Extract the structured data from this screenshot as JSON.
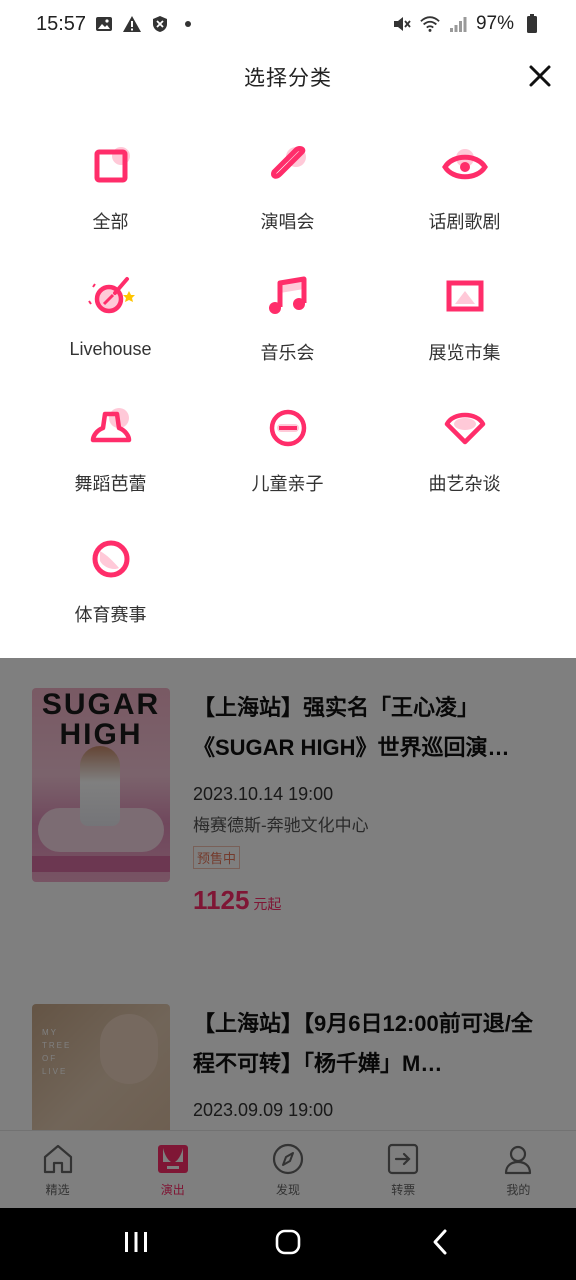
{
  "status_bar": {
    "time": "15:57",
    "battery": "97%",
    "left_icons": [
      "image-icon",
      "warning-icon",
      "shield-icon",
      "dot-icon"
    ],
    "right_icons": [
      "mute-icon",
      "wifi-icon",
      "signal-icon",
      "battery-icon"
    ]
  },
  "sheet": {
    "title": "选择分类",
    "close_icon": "close-icon",
    "categories": [
      {
        "label": "全部",
        "icon": "all-icon"
      },
      {
        "label": "演唱会",
        "icon": "microphone-icon"
      },
      {
        "label": "话剧歌剧",
        "icon": "eye-mask-icon"
      },
      {
        "label": "Livehouse",
        "icon": "guitar-icon"
      },
      {
        "label": "音乐会",
        "icon": "music-note-icon"
      },
      {
        "label": "展览市集",
        "icon": "picture-frame-icon"
      },
      {
        "label": "舞蹈芭蕾",
        "icon": "tutu-icon"
      },
      {
        "label": "儿童亲子",
        "icon": "circle-minus-icon"
      },
      {
        "label": "曲艺杂谈",
        "icon": "fan-icon"
      },
      {
        "label": "体育赛事",
        "icon": "ball-icon"
      }
    ],
    "accent_color": "#ff2d6a"
  },
  "events": [
    {
      "poster_text": [
        "SUGAR",
        "HIGH"
      ],
      "title": "【上海站】强实名「王心凌」《SUGAR HIGH》世界巡回演…",
      "time": "2023.10.14 19:00",
      "venue": "梅赛德斯-奔驰文化中心",
      "badge": "预售中",
      "price": "1125",
      "price_unit": "元起"
    },
    {
      "poster_text": [
        "MY",
        "TREE",
        "OF",
        "LIVE"
      ],
      "title": "【上海站】【9月6日12:00前可退/全程不可转】「杨千嬅」M…",
      "time": "2023.09.09 19:00"
    }
  ],
  "tabs": [
    {
      "label": "精选",
      "icon": "home-icon"
    },
    {
      "label": "演出",
      "icon": "stage-icon"
    },
    {
      "label": "发现",
      "icon": "compass-icon"
    },
    {
      "label": "转票",
      "icon": "transfer-icon"
    },
    {
      "label": "我的",
      "icon": "user-icon"
    }
  ],
  "active_tab": "演出",
  "nav_bar": [
    "recent-apps-icon",
    "home-circle-icon",
    "back-icon"
  ]
}
